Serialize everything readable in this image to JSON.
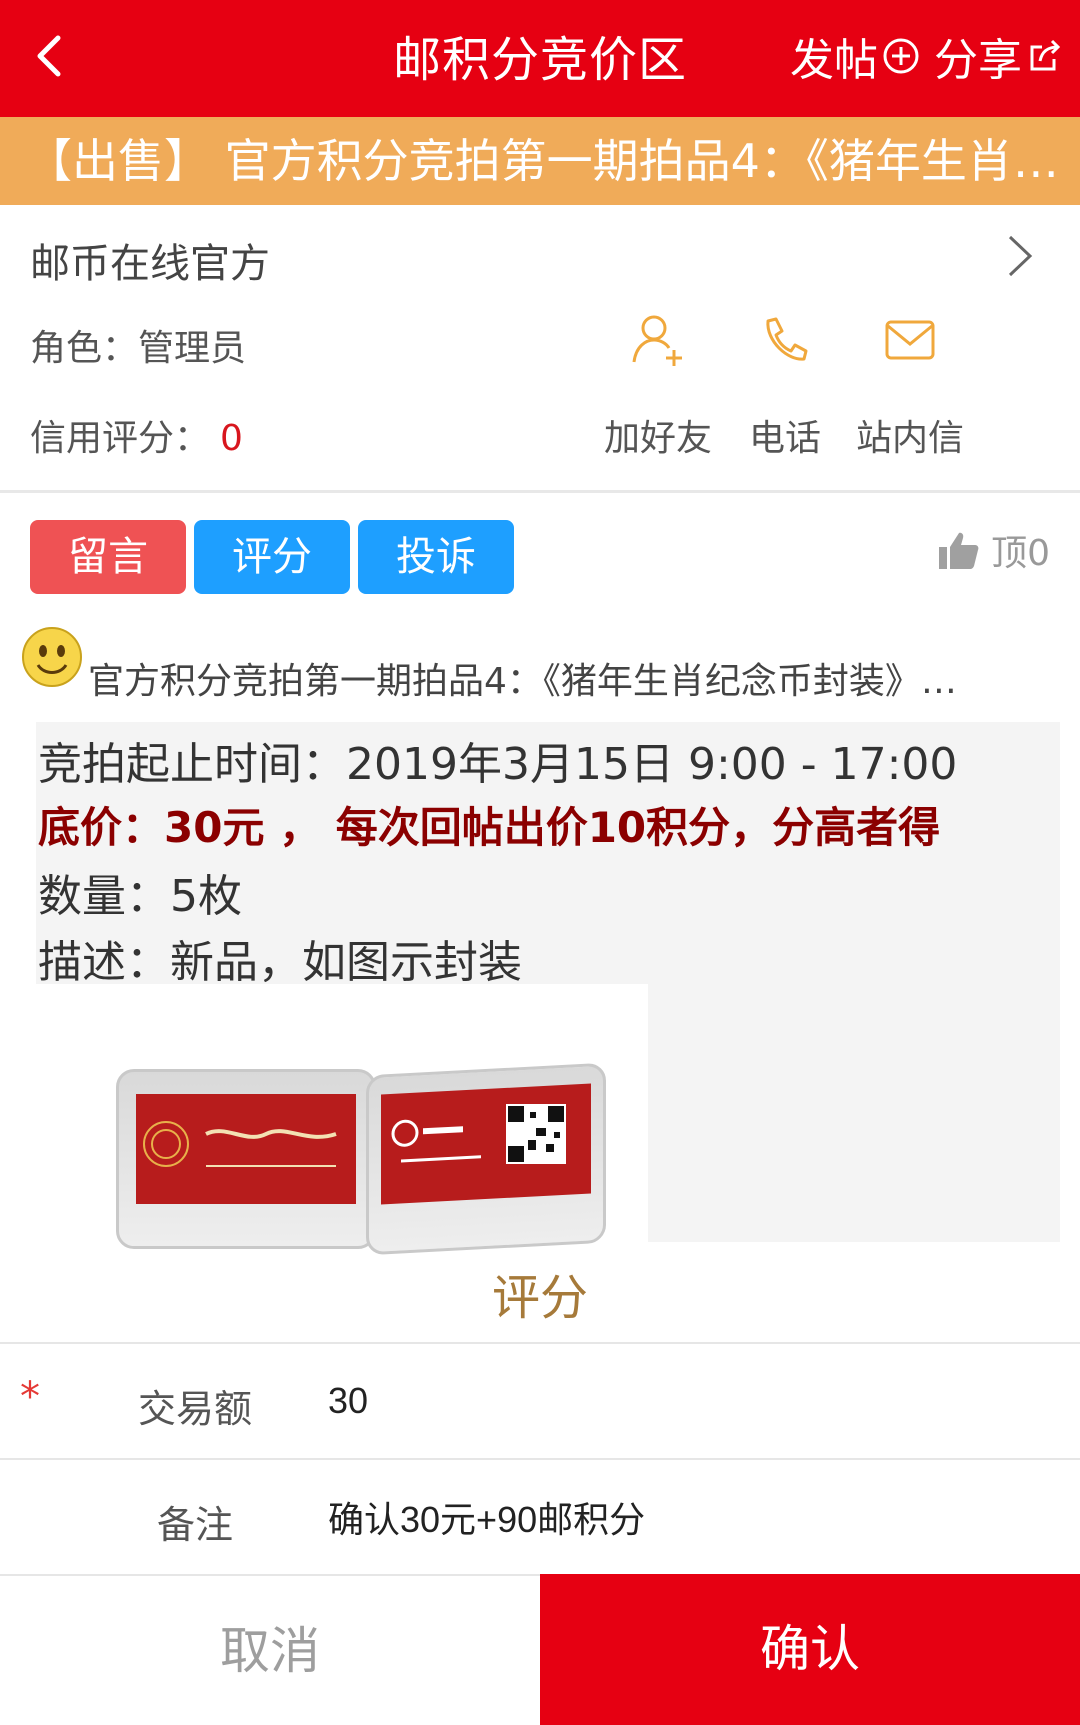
{
  "header": {
    "title": "邮积分竞价区",
    "post_label": "发帖",
    "share_label": "分享"
  },
  "subject": "【出售】 官方积分竞拍第一期拍品4：《猪年生肖…",
  "user": {
    "name": "邮币在线官方",
    "role": "角色：管理员",
    "credit_label": "信用评分：",
    "credit_value": "0",
    "actions": [
      {
        "label": "加好友",
        "icon": "add-friend-icon"
      },
      {
        "label": "电话",
        "icon": "phone-icon"
      },
      {
        "label": "站内信",
        "icon": "mail-icon"
      }
    ]
  },
  "tabs": [
    {
      "label": "留言",
      "color": "#ef5254"
    },
    {
      "label": "评分",
      "color": "#1e9fff"
    },
    {
      "label": "投诉",
      "color": "#1e9fff"
    }
  ],
  "like": {
    "label": "顶0",
    "icon": "thumbs-up-icon"
  },
  "post": {
    "title": "官方积分竞拍第一期拍品4：《猪年生肖纪念币封装》…",
    "lines": {
      "time": "竞拍起止时间：2019年3月15日 9:00 - 17:00",
      "price": "底价：30元 ， 每次回帖出价10积分，分高者得",
      "qty": "数量：5枚",
      "desc": "描述：新品，如图示封装"
    }
  },
  "rating": {
    "title": "评分",
    "amount_label": "交易额",
    "amount_value": "30",
    "note_label": "备注",
    "note_value": "确认30元+90邮积分"
  },
  "footer": {
    "cancel": "取消",
    "confirm": "确认"
  },
  "colors": {
    "brand_red": "#e60012",
    "banner_orange": "#f0ab59",
    "tab_blue": "#1e9fff",
    "tab_red": "#ef5254"
  }
}
